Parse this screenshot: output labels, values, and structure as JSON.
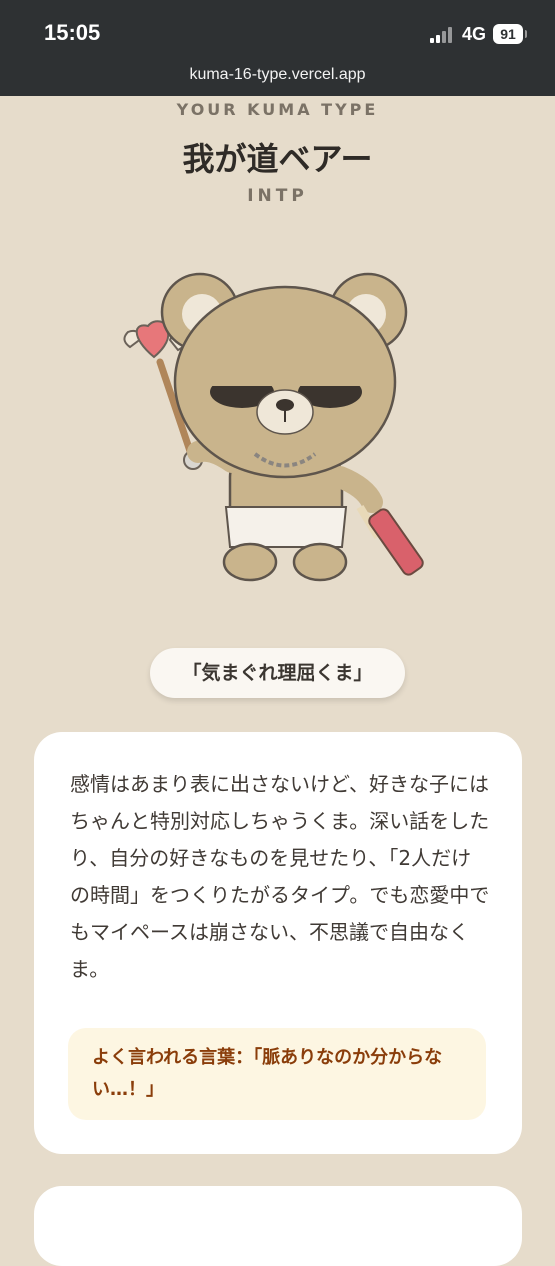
{
  "status_bar": {
    "time": "15:05",
    "network": "4G",
    "battery": "91",
    "url": "kuma-16-type.vercel.app"
  },
  "result": {
    "eyebrow": "YOUR KUMA TYPE",
    "title": "我が道ベアー",
    "code": "INTP",
    "nickname": "「気まぐれ理屈くま」",
    "description": "感情はあまり表に出さないけど、好きな子にはちゃんと特別対応しちゃうくま。深い話をしたり、自分の好きなものを見せたり、「2人だけの時間」をつくりたがるタイプ。でも恋愛中でもマイペースは崩さない、不思議で自由なくま。",
    "quote": "よく言われる言葉：「脈ありなのか分からない…！」"
  },
  "colors": {
    "background": "#e6dccb",
    "card": "#ffffff",
    "quote_bg": "#fdf6e2",
    "quote_text": "#8a3d0a",
    "status_bar": "#2e3133"
  },
  "icons": [
    "signal-icon",
    "battery-icon",
    "bear-illustration"
  ]
}
